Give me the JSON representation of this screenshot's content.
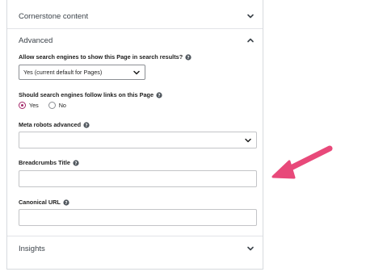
{
  "sections": {
    "cornerstone": {
      "title": "Cornerstone content"
    },
    "advanced": {
      "title": "Advanced"
    },
    "insights": {
      "title": "Insights"
    }
  },
  "fields": {
    "search_engines_show": {
      "label": "Allow search engines to show this Page in search results?",
      "selected": "Yes (current default for Pages)"
    },
    "search_engines_follow": {
      "label": "Should search engines follow links on this Page",
      "options": [
        "Yes",
        "No"
      ],
      "selected": "Yes"
    },
    "meta_robots": {
      "label": "Meta robots advanced",
      "selected": ""
    },
    "breadcrumbs_title": {
      "label": "Breadcrumbs Title",
      "value": ""
    },
    "canonical_url": {
      "label": "Canonical URL",
      "value": ""
    }
  },
  "colors": {
    "accent_radio": "#a4286a",
    "arrow": "#e8497a",
    "border": "#c3c4c7"
  },
  "icons": {
    "help": "question-circle-icon",
    "chevron_down": "chevron-down-icon",
    "chevron_up": "chevron-up-icon",
    "annotation_arrow": "pink-arrow-icon"
  }
}
